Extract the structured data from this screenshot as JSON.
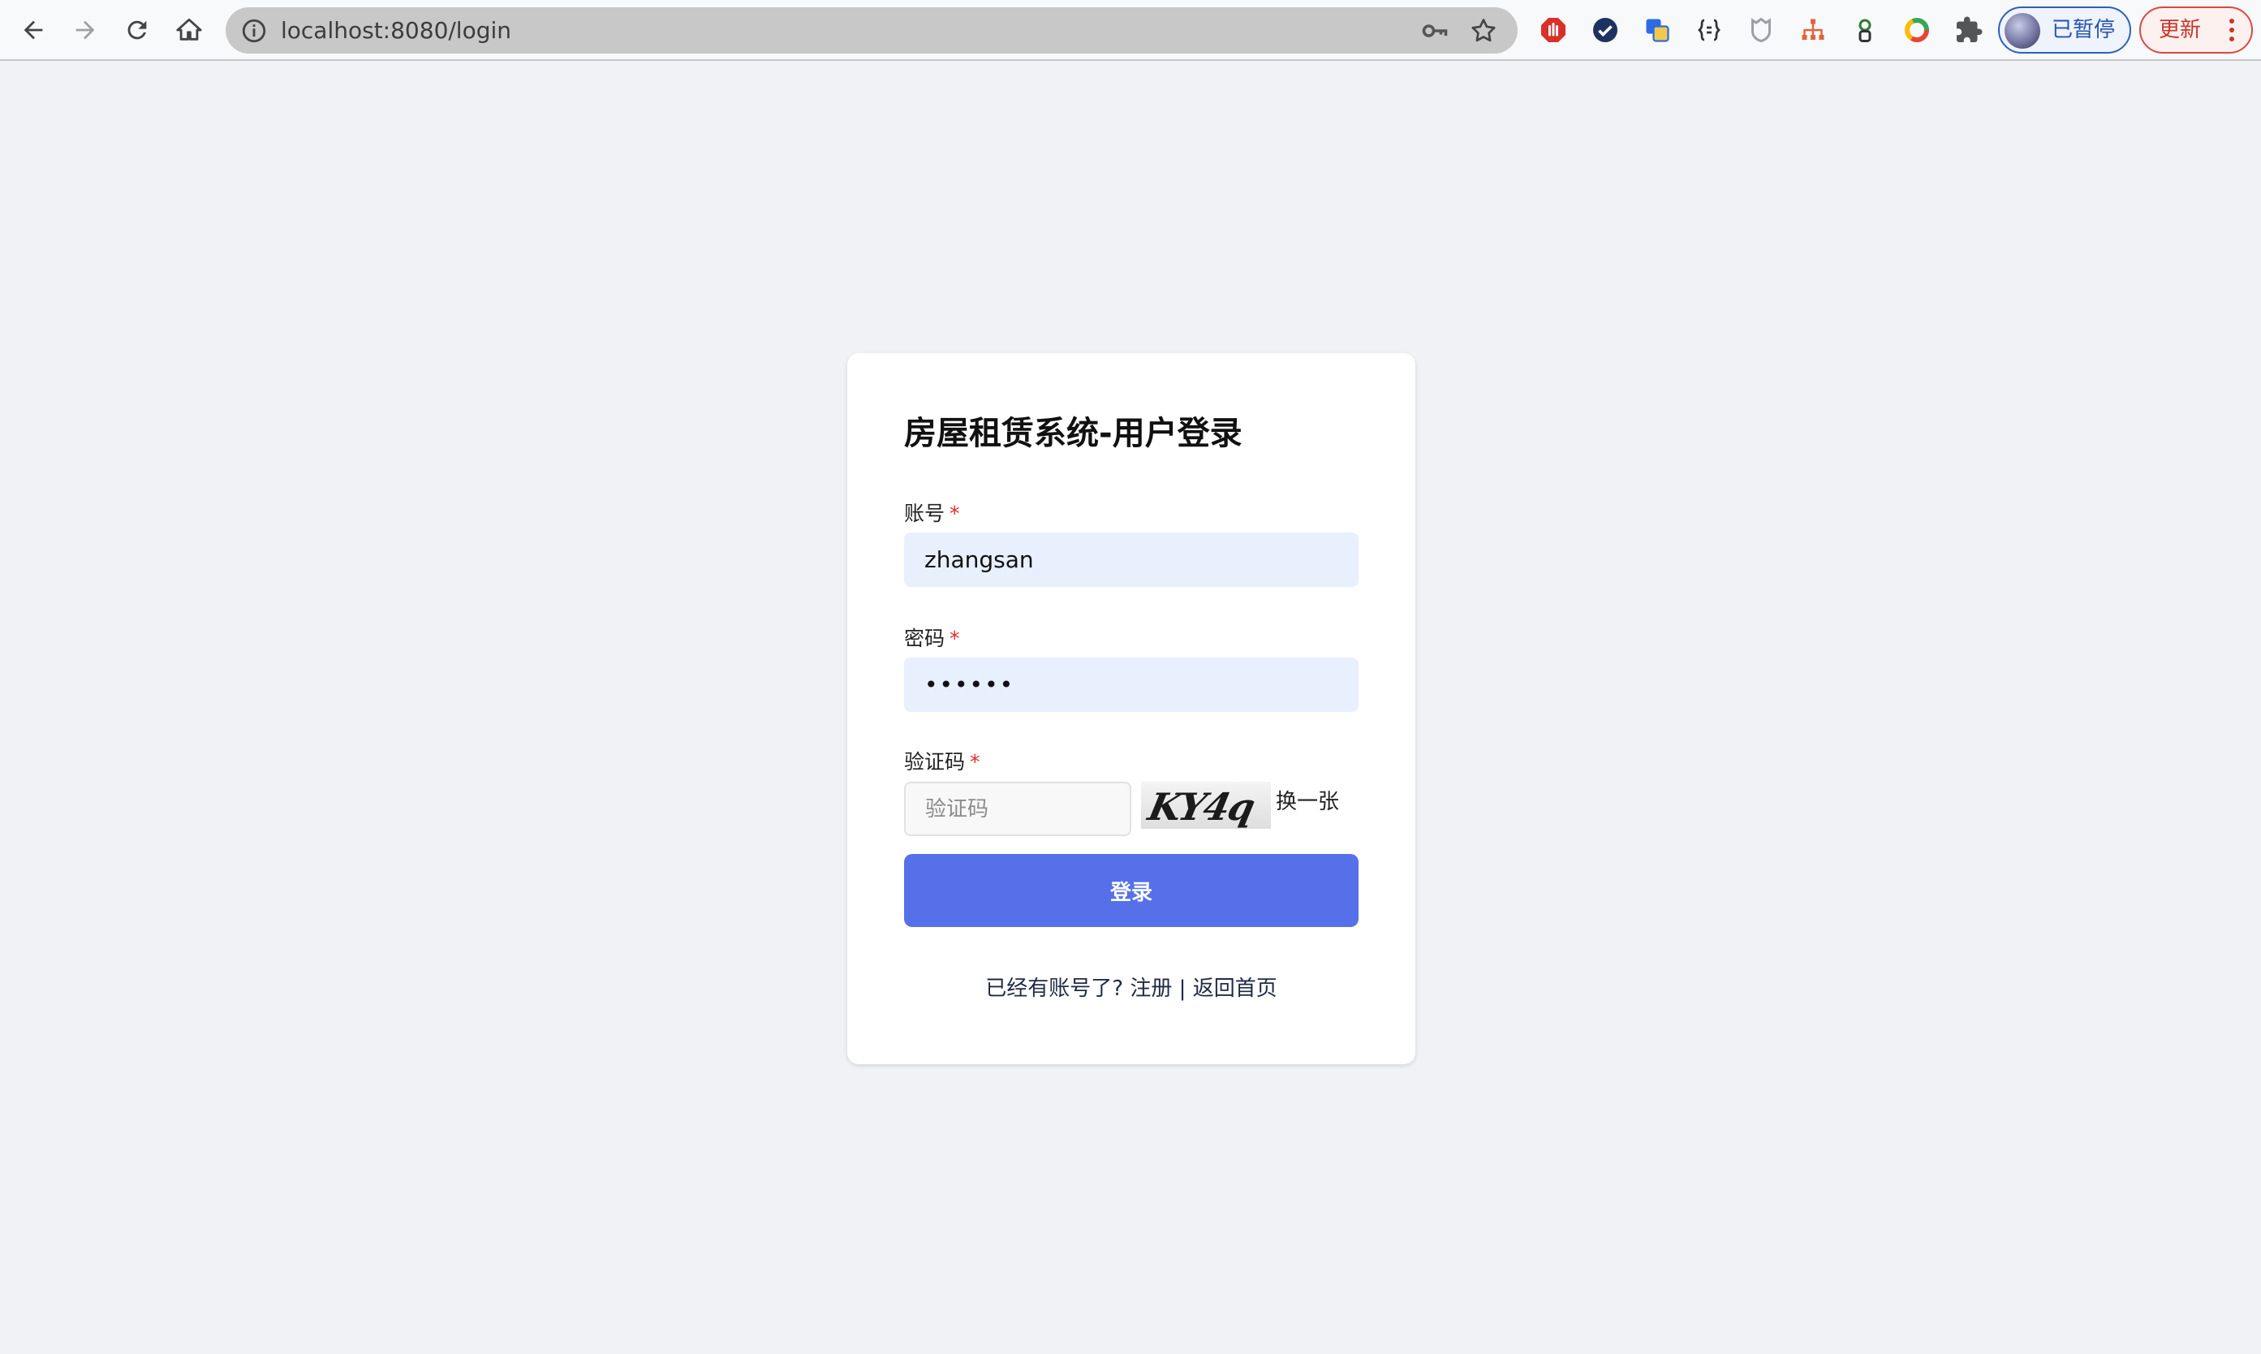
{
  "browser": {
    "url": "localhost:8080/login",
    "profile_label": "已暂停",
    "update_label": "更新"
  },
  "login": {
    "title": "房屋租赁系统-用户登录",
    "account": {
      "label": "账号",
      "required_mark": "*",
      "value": "zhangsan"
    },
    "password": {
      "label": "密码",
      "required_mark": "*",
      "value": "••••••"
    },
    "captcha": {
      "label": "验证码",
      "required_mark": "*",
      "placeholder": "验证码",
      "image_text": "KY4q",
      "refresh_label": "换一张"
    },
    "submit_label": "登录",
    "footer": {
      "prompt": "已经有账号了?",
      "register_label": "注册",
      "separator": "|",
      "home_label": "返回首页"
    }
  },
  "colors": {
    "primary": "#5570e9",
    "input_bg": "#e8f0fe",
    "required": "#e02d2d",
    "page_bg": "#f1f2f5"
  }
}
